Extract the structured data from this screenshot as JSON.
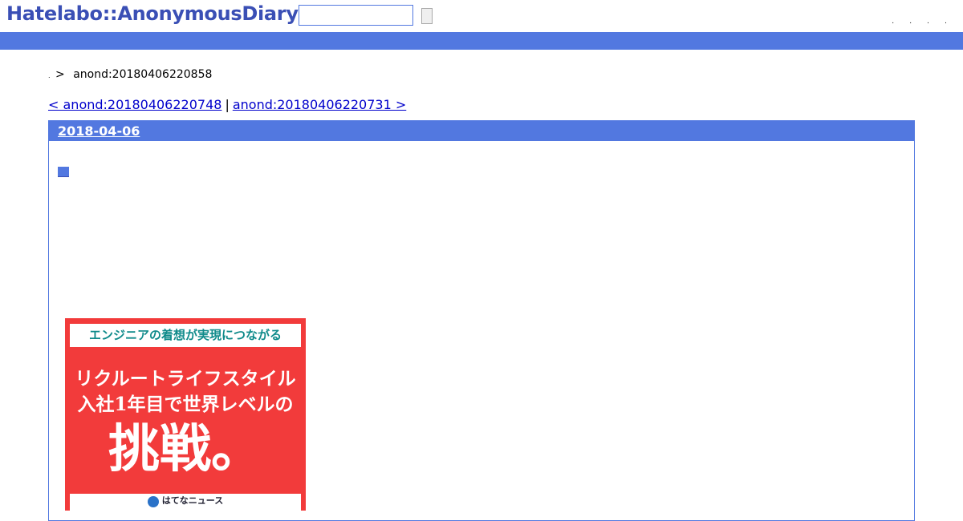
{
  "header": {
    "logo": "Hatelabo::AnonymousDiary",
    "search": {
      "value": "",
      "button_label": ""
    },
    "links": [
      ".",
      ".",
      ".",
      "."
    ]
  },
  "breadcrumb": {
    "home": ".",
    "separator": ">",
    "current": "anond:20180406220858"
  },
  "nav": {
    "prev_label": "< anond:20180406220748",
    "separator": "|",
    "next_label": "anond:20180406220731 >"
  },
  "entry": {
    "date": "2018-04-06",
    "square": "■"
  },
  "ad": {
    "top_text": "エンジニアの着想が実現につながる",
    "line1": "リクルートライフスタイル",
    "line2": "入社1年目で世界レベルの",
    "big": "挑戦。",
    "bottom_text": "はてなニュース",
    "colors": {
      "background": "#f23b3b",
      "top_text": "#0e8a8a"
    }
  },
  "colors": {
    "accent": "#5278e0",
    "logo": "#3a4fb5",
    "link": "#0000cc"
  }
}
